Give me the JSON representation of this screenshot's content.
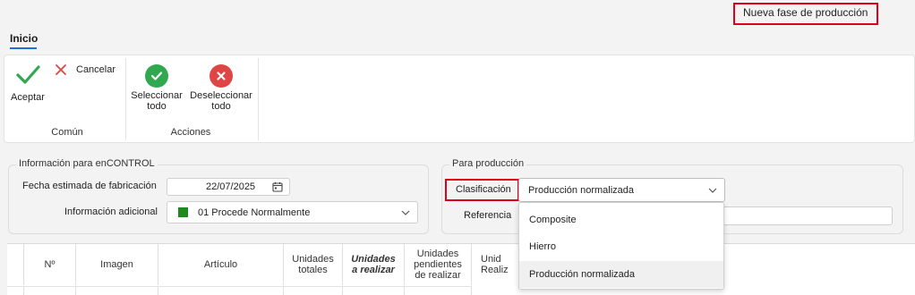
{
  "window": {
    "title": "Nueva fase de producción"
  },
  "tabs": [
    {
      "label": "Inicio",
      "active": true
    }
  ],
  "ribbon": {
    "groups": [
      {
        "label": "Común",
        "buttons": [
          {
            "label": "Aceptar",
            "icon": "checkmark-icon"
          },
          {
            "label": "Cancelar",
            "icon": "x-icon"
          }
        ]
      },
      {
        "label": "Acciones",
        "buttons": [
          {
            "label_line1": "Seleccionar",
            "label_line2": "todo",
            "icon": "check-circle-icon"
          },
          {
            "label_line1": "Deseleccionar",
            "label_line2": "todo",
            "icon": "x-circle-icon"
          }
        ]
      }
    ]
  },
  "encontrol": {
    "legend": "Información para enCONTROL",
    "fecha_label": "Fecha estimada de fabricación",
    "fecha_value": "22/07/2025",
    "info_label": "Información adicional",
    "info_value": "01 Procede Normalmente",
    "info_color": "#1e8a1e"
  },
  "produccion": {
    "legend": "Para producción",
    "clasificacion_label": "Clasificación",
    "clasificacion_value": "Producción normalizada",
    "referencia_label": "Referencia",
    "options": [
      "Composite",
      "Hierro",
      "Producción normalizada"
    ],
    "selected": "Producción normalizada"
  },
  "grid": {
    "columns": [
      {
        "label": "Nº"
      },
      {
        "label": "Imagen"
      },
      {
        "label": "Artículo"
      },
      {
        "line1": "Unidades",
        "line2": "totales"
      },
      {
        "line1": "Unidades",
        "line2": "a realizar"
      },
      {
        "line1": "Unidades",
        "line2": "pendientes",
        "line3": "de realizar"
      },
      {
        "line1": "Unid",
        "line2": "Realiz"
      }
    ]
  },
  "colors": {
    "accent": "#1e6fd9",
    "highlight": "#e0001b",
    "ok_green": "#2fa84f",
    "cancel_red": "#e04545"
  }
}
